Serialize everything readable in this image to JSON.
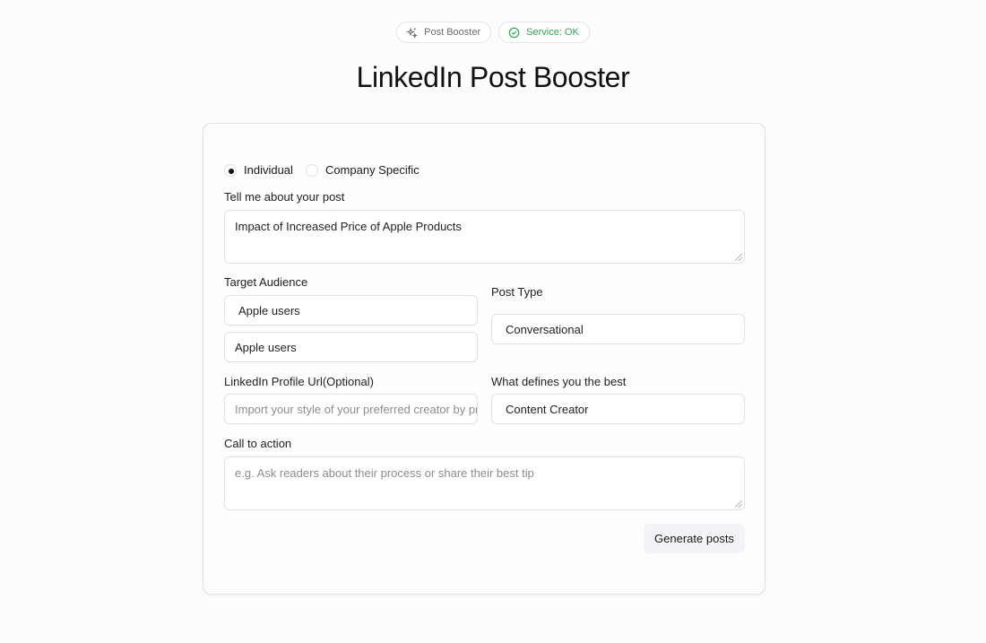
{
  "badges": {
    "booster_label": "Post Booster",
    "service_label": "Service: OK",
    "ok_color": "#2fa552"
  },
  "page_title": "LinkedIn Post Booster",
  "form": {
    "mode_options": [
      {
        "label": "Individual",
        "checked": true
      },
      {
        "label": "Company Specific",
        "checked": false
      }
    ],
    "post_topic": {
      "label": "Tell me about your post",
      "value": "Impact of Increased Price of Apple Products"
    },
    "target_audience": {
      "label": "Target Audience",
      "selected": "Apple users",
      "input_value": "Apple users"
    },
    "post_type": {
      "label": "Post Type",
      "value": "Conversational"
    },
    "profile_url": {
      "label": "LinkedIn Profile Url(Optional)",
      "placeholder": "Import your style of your preferred creator by pr"
    },
    "defines_you": {
      "label": "What defines you the best",
      "value": "Content Creator"
    },
    "call_to_action": {
      "label": "Call to action",
      "placeholder": "e.g. Ask readers about their process or share their best tip"
    },
    "submit_label": "Generate posts"
  }
}
